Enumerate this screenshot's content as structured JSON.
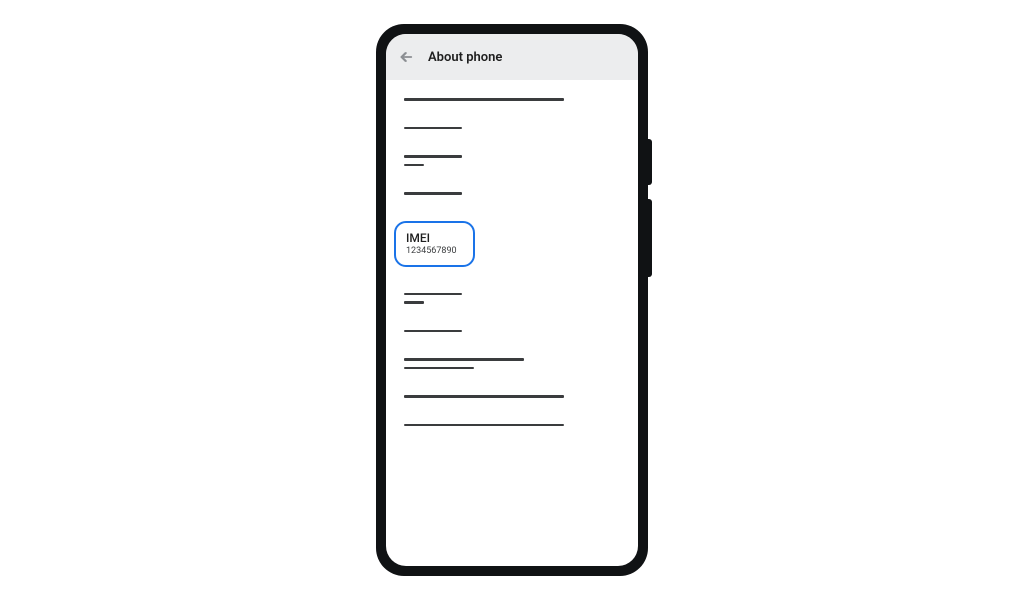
{
  "header": {
    "title": "About phone"
  },
  "imei": {
    "label": "IMEI",
    "value": "1234567890"
  }
}
